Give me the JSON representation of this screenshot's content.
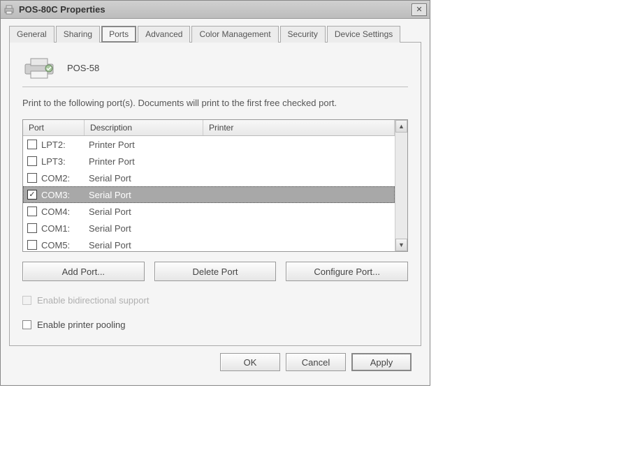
{
  "window": {
    "title": "POS-80C Properties"
  },
  "tabs": {
    "items": [
      {
        "label": "General"
      },
      {
        "label": "Sharing"
      },
      {
        "label": "Ports"
      },
      {
        "label": "Advanced"
      },
      {
        "label": "Color Management"
      },
      {
        "label": "Security"
      },
      {
        "label": "Device Settings"
      }
    ],
    "active_index": 2
  },
  "ports_panel": {
    "printer_name": "POS-58",
    "description": "Print to the following port(s). Documents will print to the first free checked port.",
    "columns": {
      "port": "Port",
      "description": "Description",
      "printer": "Printer"
    },
    "rows": [
      {
        "checked": false,
        "port": "LPT2:",
        "description": "Printer Port",
        "printer": ""
      },
      {
        "checked": false,
        "port": "LPT3:",
        "description": "Printer Port",
        "printer": ""
      },
      {
        "checked": false,
        "port": "COM2:",
        "description": "Serial Port",
        "printer": ""
      },
      {
        "checked": true,
        "port": "COM3:",
        "description": "Serial Port",
        "printer": "",
        "selected": true
      },
      {
        "checked": false,
        "port": "COM4:",
        "description": "Serial Port",
        "printer": ""
      },
      {
        "checked": false,
        "port": "COM1:",
        "description": "Serial Port",
        "printer": ""
      },
      {
        "checked": false,
        "port": "COM5:",
        "description": "Serial Port",
        "printer": ""
      }
    ],
    "buttons": {
      "add": "Add Port...",
      "delete": "Delete Port",
      "configure": "Configure Port..."
    },
    "bidirectional": {
      "label": "Enable bidirectional support",
      "enabled": false,
      "checked": false
    },
    "pooling": {
      "label": "Enable printer pooling",
      "enabled": true,
      "checked": false
    }
  },
  "footer": {
    "ok": "OK",
    "cancel": "Cancel",
    "apply": "Apply"
  }
}
